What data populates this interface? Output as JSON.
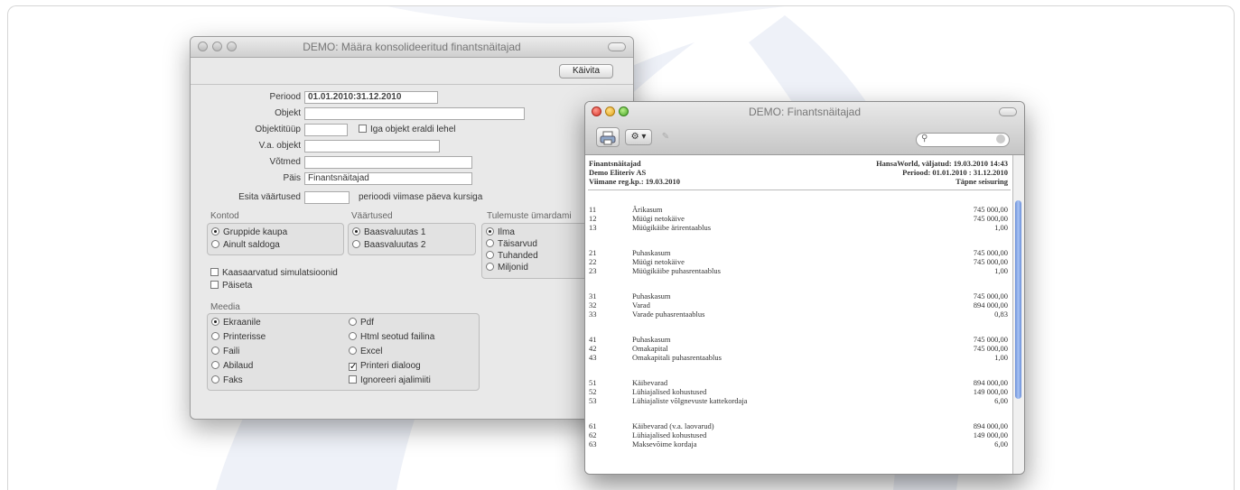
{
  "left_window": {
    "title": "DEMO: Määra konsolideeritud finantsnäitajad",
    "run_button": "Käivita",
    "fields": [
      {
        "label": "Periood",
        "value": "01.01.2010:31.12.2010"
      },
      {
        "label": "Objekt",
        "value": ""
      },
      {
        "label": "Objektitüüp",
        "value": ""
      },
      {
        "label": "V.a. objekt",
        "value": ""
      },
      {
        "label": "Võtmed",
        "value": ""
      },
      {
        "label": "Päis",
        "value": "Finantsnäitajad"
      },
      {
        "label": "Esita väärtused",
        "value": ""
      }
    ],
    "separate_page_checkbox": "Iga objekt eraldi lehel",
    "values_suffix": "perioodi viimase päeva kursiga",
    "groups": {
      "kontod": {
        "title": "Kontod",
        "options": [
          "Gruppide kaupa",
          "Ainult saldoga"
        ],
        "selected": 0
      },
      "vaartused": {
        "title": "Väärtused",
        "options": [
          "Baasvaluutas 1",
          "Baasvaluutas 2"
        ],
        "selected": 0
      },
      "rounding": {
        "title": "Tulemuste ümardami",
        "options": [
          "Ilma",
          "Täisarvud",
          "Tuhanded",
          "Miljonid"
        ],
        "selected": 0
      }
    },
    "checkboxes": [
      "Kaasaarvatud simulatsioonid",
      "Päiseta"
    ],
    "media": {
      "title": "Meedia",
      "left": [
        "Ekraanile",
        "Printerisse",
        "Faili",
        "Abilaud",
        "Faks"
      ],
      "left_selected": 0,
      "right": [
        "Pdf",
        "Html seotud failina",
        "Excel",
        "Printeri dialoog",
        "Ignoreeri ajalimiiti"
      ],
      "right_types": [
        "radio",
        "radio",
        "radio",
        "check",
        "check"
      ],
      "right_checked": [
        false,
        false,
        false,
        true,
        false
      ]
    }
  },
  "right_window": {
    "title": "DEMO: Finantsnäitajad",
    "report": {
      "title": "Finantsnäitajad",
      "company": "Demo Eliteriv AS",
      "last_date": "Viimane reg.kp.: 19.03.2010",
      "system": "HansaWorld, väljatud: 19.03.2010 14:43",
      "period": "Periood: 01.01.2010 : 31.12.2010",
      "status": "Täpne seisuring"
    },
    "groups": [
      [
        [
          "11",
          "Ärikasum",
          "745 000,00"
        ],
        [
          "12",
          "Müügi netokäive",
          "745 000,00"
        ],
        [
          "13",
          "Müügikäibe ärirentaablus",
          "1,00"
        ]
      ],
      [
        [
          "21",
          "Puhaskasum",
          "745 000,00"
        ],
        [
          "22",
          "Müügi netokäive",
          "745 000,00"
        ],
        [
          "23",
          "Müügikäibe puhasrentaablus",
          "1,00"
        ]
      ],
      [
        [
          "31",
          "Puhaskasum",
          "745 000,00"
        ],
        [
          "32",
          "Varad",
          "894 000,00"
        ],
        [
          "33",
          "Varade puhasrentaablus",
          "0,83"
        ]
      ],
      [
        [
          "41",
          "Puhaskasum",
          "745 000,00"
        ],
        [
          "42",
          "Omakapital",
          "745 000,00"
        ],
        [
          "43",
          "Omakapitali puhasrentaablus",
          "1,00"
        ]
      ],
      [
        [
          "51",
          "Käibevarad",
          "894 000,00"
        ],
        [
          "52",
          "Lühiajalised kohustused",
          "149 000,00"
        ],
        [
          "53",
          "Lühiajaliste võlgnevuste kattekordaja",
          "6,00"
        ]
      ],
      [
        [
          "61",
          "Käibevarad (v.a. laovarud)",
          "894 000,00"
        ],
        [
          "62",
          "Lühiajalised kohustused",
          "149 000,00"
        ],
        [
          "63",
          "Maksevõime kordaja",
          "6,00"
        ]
      ]
    ]
  }
}
